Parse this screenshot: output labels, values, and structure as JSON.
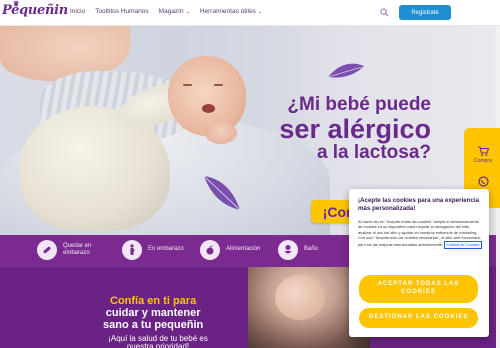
{
  "header": {
    "logo": "Pequeñin",
    "nav": [
      {
        "label": "Inicio",
        "has_caret": false
      },
      {
        "label": "Tooltitos Humanos",
        "has_caret": false
      },
      {
        "label": "Magazín",
        "has_caret": true
      },
      {
        "label": "Herramientas útiles",
        "has_caret": true
      }
    ],
    "register_label": "Registrate"
  },
  "hero": {
    "line1": "¿Mi bebé puede",
    "line2": "ser alérgico",
    "line3": "a la lactosa?",
    "cta_label": "¡Conoce más!"
  },
  "side_float": {
    "items": [
      {
        "label": "Compra",
        "icon": "cart-icon"
      },
      {
        "label": "",
        "icon": "whatsapp-icon"
      }
    ]
  },
  "categories": [
    {
      "label": "Quedar en embarazo",
      "icon": "test-icon"
    },
    {
      "label": "En embarazo",
      "icon": "pregnant-icon"
    },
    {
      "label": "Alimentación",
      "icon": "apple-icon"
    },
    {
      "label": "Baño",
      "icon": "baby-bath-icon"
    }
  ],
  "bottom": {
    "tagline_part1": "Confía en ti para",
    "tagline_part2": "cuidar y mantener",
    "tagline_part3": "sano a tu pequeñin",
    "subtitle": "¡Aquí la salud de tu bebé es nuestra prioridad!"
  },
  "cookie": {
    "title": "¡Acepte las cookies para una experiencia más personalizada!",
    "body": "Al hacer clic en \"Aceptar todas las cookies\" acepta el almacenamiento de cookies en su dispositivo para mejorar la navegación del sitio, analizar el uso del sitio y ayudar en nuestros esfuerzos de marketing. Con solo \"Aceptar solo las cookies necesarias\", el sitio web funcionará, pero sin las mejoras mencionadas anteriormente.",
    "policy_link": "Política de Cookies",
    "accept_label": "ACEPTAR TODAS LAS COOKIES",
    "manage_label": "GESTIONAR LAS COOKIES"
  },
  "colors": {
    "brand_purple": "#6a2a8c",
    "accent_yellow": "#ffc400",
    "register_blue": "#1f8fd3"
  }
}
